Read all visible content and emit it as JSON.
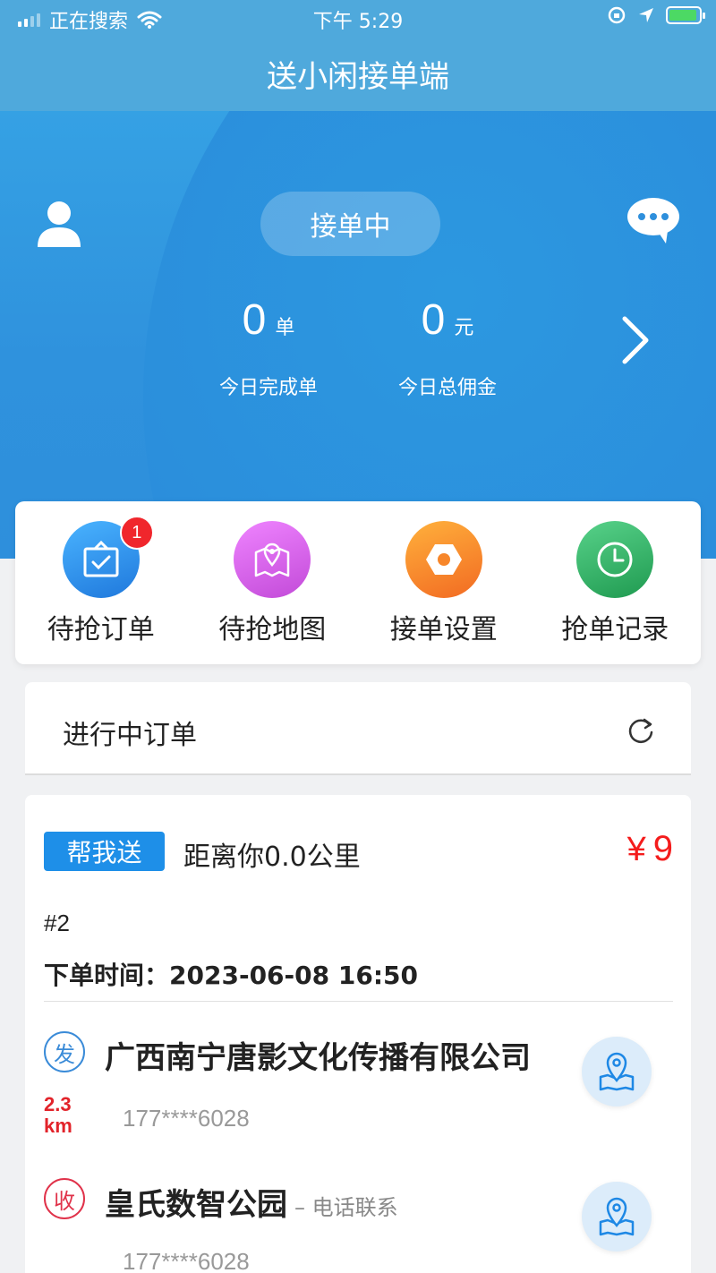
{
  "status_bar": {
    "carrier": "正在搜索",
    "time": "下午 5:29"
  },
  "header": {
    "title": "送小闲接单端"
  },
  "hero": {
    "status_label": "接单中",
    "stats": [
      {
        "value": "0",
        "unit": "单",
        "label": "今日完成单"
      },
      {
        "value": "0",
        "unit": "元",
        "label": "今日总佣金"
      }
    ]
  },
  "actions": [
    {
      "label": "待抢订单",
      "icon": "clipboard-check-icon",
      "badge": "1",
      "color": "#2f8de6"
    },
    {
      "label": "待抢地图",
      "icon": "map-pin-icon",
      "color": "#cc5be0"
    },
    {
      "label": "接单设置",
      "icon": "hexagon-settings-icon",
      "color": "#f7862a"
    },
    {
      "label": "抢单记录",
      "icon": "clock-icon",
      "color": "#2fae61"
    }
  ],
  "in_progress": {
    "title": "进行中订单"
  },
  "order": {
    "type_tag": "帮我送",
    "distance": "距离你0.0公里",
    "currency": "¥",
    "price": "9",
    "number": "#2",
    "time_label": "下单时间：",
    "time_value": "2023-06-08 16:50",
    "sender": {
      "mark": "发",
      "name": "广西南宁唐影文化传播有限公司",
      "phone": "177****6028"
    },
    "distance_km": "2.3",
    "distance_unit": "km",
    "receiver": {
      "mark": "收",
      "name": "皇氏数智公园",
      "contact": "– 电话联系",
      "phone": "177****6028"
    }
  }
}
